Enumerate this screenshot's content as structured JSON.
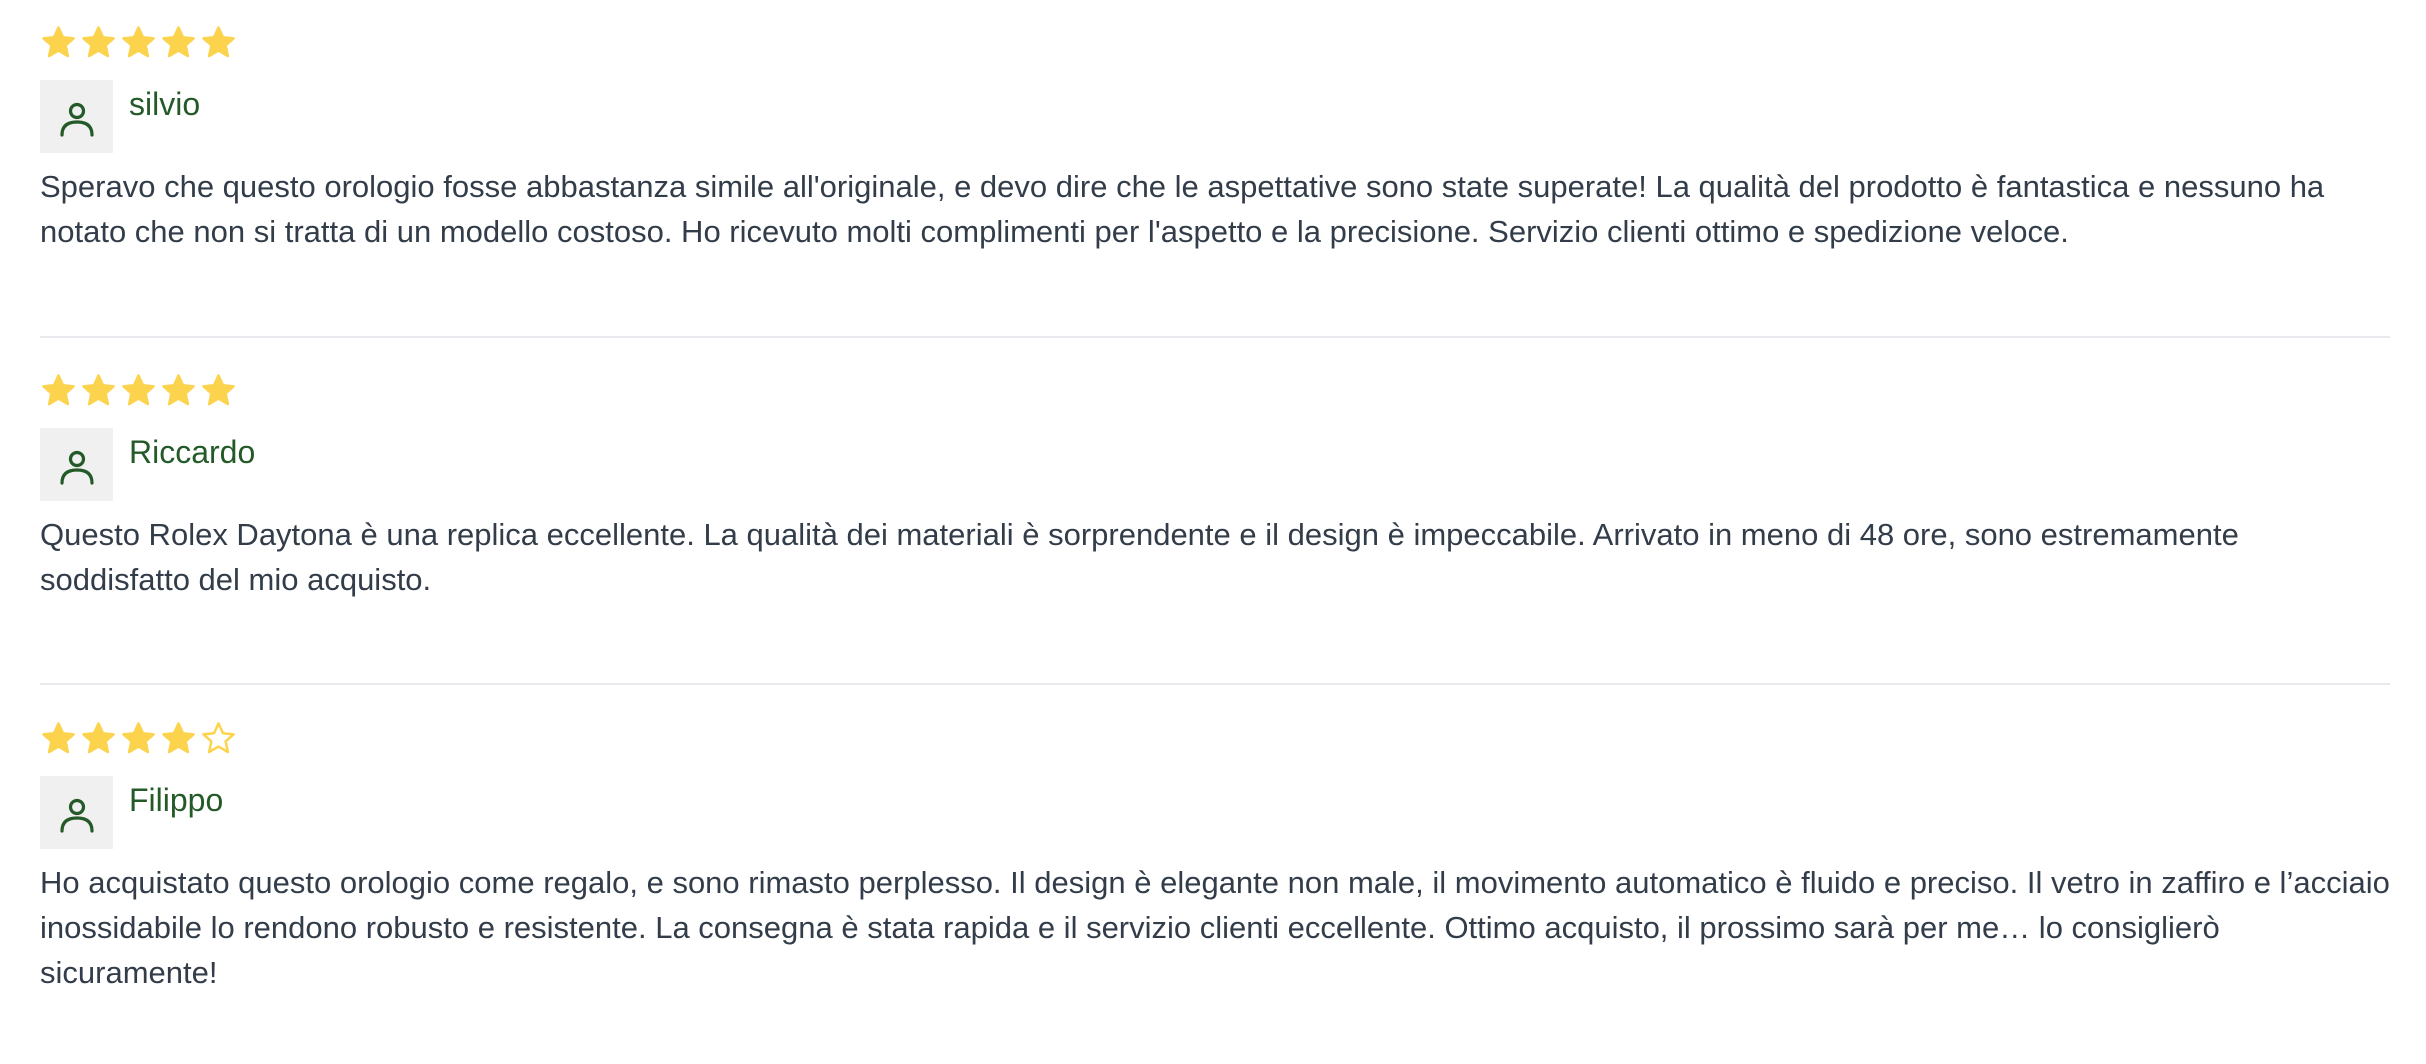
{
  "colors": {
    "star_fill": "#fcd34d",
    "star_outline": "#fcd34d",
    "author_name": "#245a28",
    "review_text": "#333d4a",
    "avatar_bg": "#eff0ef",
    "divider": "#e7e9ec"
  },
  "icons": {
    "star_full": "star-filled-icon",
    "star_empty": "star-outline-icon",
    "avatar": "user-icon"
  },
  "reviews": [
    {
      "rating": 5,
      "max_rating": 5,
      "author": "silvio",
      "text": "Speravo che questo orologio fosse abbastanza simile all'originale, e devo dire che le aspettative sono state superate! La qualità del prodotto è fantastica e nessuno ha notato che non si tratta di un modello costoso. Ho ricevuto molti complimenti per l'aspetto e la precisione. Servizio clienti ottimo e spedizione veloce."
    },
    {
      "rating": 5,
      "max_rating": 5,
      "author": "Riccardo",
      "text": "Questo Rolex Daytona è una replica eccellente. La qualità dei materiali è sorprendente e il design è impeccabile. Arrivato in meno di 48 ore, sono estremamente soddisfatto del mio acquisto."
    },
    {
      "rating": 4,
      "max_rating": 5,
      "author": "Filippo",
      "text": "Ho acquistato questo orologio come regalo, e sono rimasto perplesso. Il design è elegante non male, il movimento automatico è fluido e preciso. Il vetro in zaffiro e l’acciaio inossidabile lo rendono robusto e resistente. La consegna è stata rapida e il servizio clienti eccellente. Ottimo acquisto, il prossimo sarà per me… lo consiglierò sicuramente!"
    }
  ]
}
